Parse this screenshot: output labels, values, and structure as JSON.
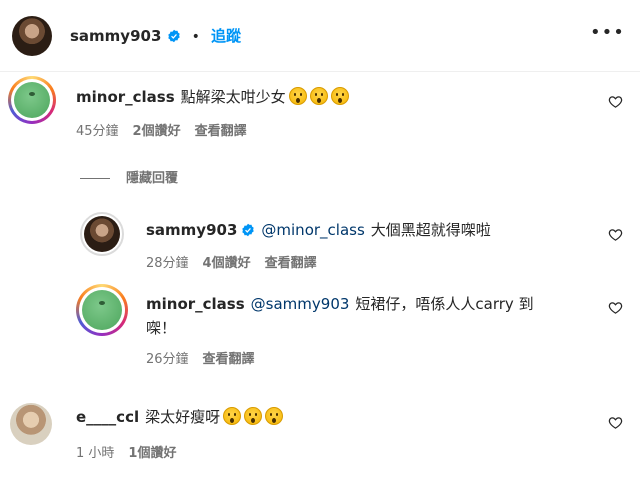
{
  "header": {
    "username": "sammy903",
    "separator": "•",
    "follow_label": "追蹤",
    "more_label": "•••"
  },
  "hide_replies_label": "隱藏回覆",
  "comments": [
    {
      "username": "minor_class",
      "text": "點解梁太咁少女",
      "emojis": [
        "astonished-face",
        "astonished-face",
        "astonished-face"
      ],
      "time": "45分鐘",
      "likes": "2個讚好",
      "translate": "查看翻譯"
    },
    {
      "username": "sammy903",
      "mention": "@minor_class",
      "text": "大個黑超就得㗎啦",
      "time": "28分鐘",
      "likes": "4個讚好",
      "translate": "查看翻譯"
    },
    {
      "username": "minor_class",
      "mention": "@sammy903",
      "text_line1": "短裙仔，唔係人人carry 到",
      "text_line2": "㗎！",
      "time": "26分鐘",
      "translate": "查看翻譯"
    },
    {
      "username": "e____ccl",
      "text": "梁太好瘦呀",
      "emojis": [
        "astonished-face",
        "astonished-face",
        "astonished-face"
      ],
      "time": "1 小時",
      "likes": "1個讚好"
    }
  ],
  "colors": {
    "link_blue": "#0095f6",
    "mention_blue": "#00376b",
    "meta_gray": "#737373"
  }
}
